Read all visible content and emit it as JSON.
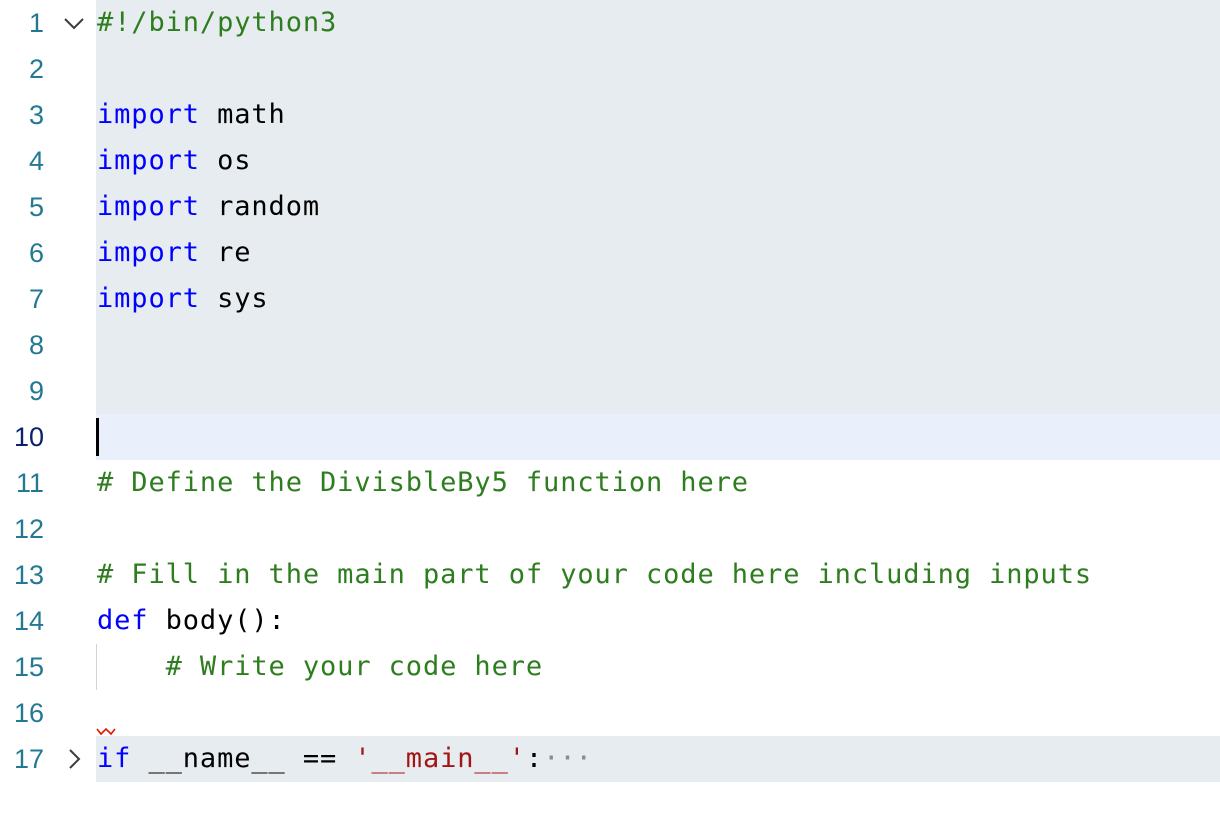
{
  "editor": {
    "lines": [
      {
        "num": "1",
        "parts": {
          "a": "#!/bin/python3"
        }
      },
      {
        "num": "2"
      },
      {
        "num": "3",
        "parts": {
          "kw": "import",
          "rest": " math"
        }
      },
      {
        "num": "4",
        "parts": {
          "kw": "import",
          "rest": " os"
        }
      },
      {
        "num": "5",
        "parts": {
          "kw": "import",
          "rest": " random"
        }
      },
      {
        "num": "6",
        "parts": {
          "kw": "import",
          "rest": " re"
        }
      },
      {
        "num": "7",
        "parts": {
          "kw": "import",
          "rest": " sys"
        }
      },
      {
        "num": "8"
      },
      {
        "num": "9"
      },
      {
        "num": "10"
      },
      {
        "num": "11",
        "parts": {
          "a": "# Define the DivisbleBy5 function here"
        }
      },
      {
        "num": "12"
      },
      {
        "num": "13",
        "parts": {
          "a": "# Fill in the main part of your code here including inputs"
        }
      },
      {
        "num": "14",
        "parts": {
          "kw": "def",
          "rest": " body():"
        }
      },
      {
        "num": "15",
        "parts": {
          "indent": "    ",
          "a": "# Write your code here"
        }
      },
      {
        "num": "16"
      },
      {
        "num": "17",
        "parts": {
          "kw": "if",
          "rest": " __name__ == ",
          "str": "'__main__'",
          "colon": ":",
          "ellipsis": "···"
        }
      }
    ]
  },
  "colors": {
    "keyword": "#0000ff",
    "comment": "#2e7d1f",
    "string": "#a31515",
    "line_number": "#237893",
    "active_line_number": "#0b216f",
    "folded_background": "#e7ecf0",
    "current_line_background": "#e9f0fb"
  },
  "icons": {
    "line_1_fold": "chevron-down-icon",
    "line_17_fold": "chevron-right-icon",
    "line_16_marker": "error-squiggle-icon"
  }
}
